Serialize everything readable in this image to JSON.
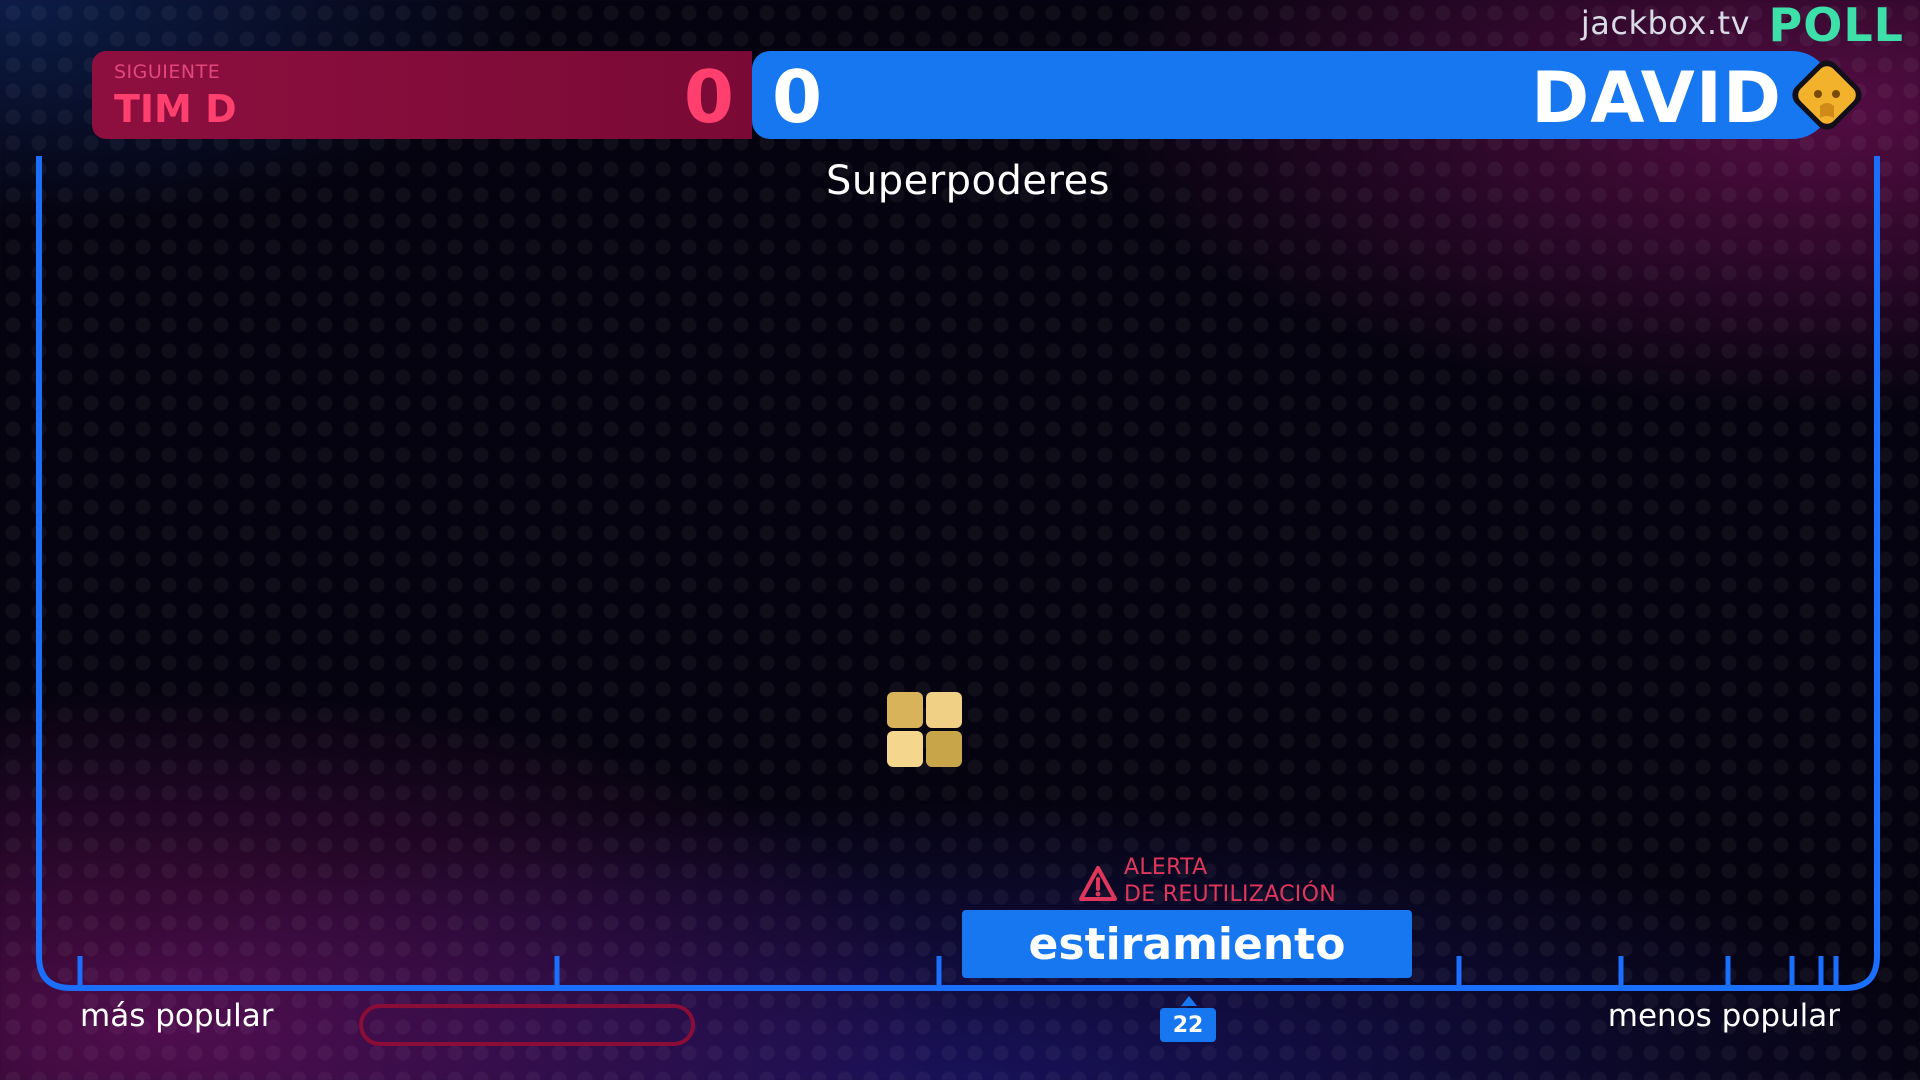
{
  "header": {
    "site": "jackbox.tv",
    "game_logo": "POLL",
    "red_team": {
      "label": "SIGUIENTE",
      "name": "TIM D",
      "score": "0"
    },
    "blue_team": {
      "score": "0",
      "name": "DAVID",
      "avatar_icon": "yellow-diamond-face-icon"
    }
  },
  "category": "Superpoderes",
  "board": {
    "warning": {
      "line1": "ALERTA",
      "line2": "DE REUTILIZACIÓN",
      "icon": "warning-triangle-icon"
    },
    "answer": "estiramiento",
    "count": "22",
    "left_label": "más popular",
    "right_label": "menos popular"
  },
  "colors": {
    "red": "#ff3f6d",
    "red_dark": "#8d0f3f",
    "blue": "#1677f0",
    "green": "#3ce0a8",
    "tile": "#e9c86c"
  }
}
